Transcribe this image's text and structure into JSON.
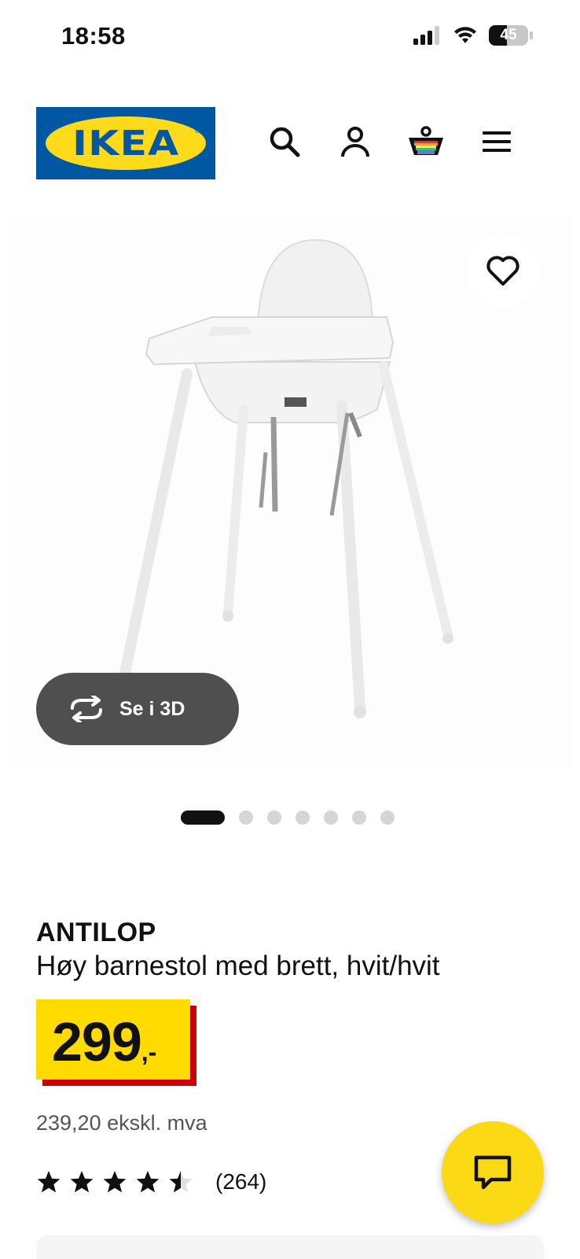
{
  "status_bar": {
    "time": "18:58",
    "battery": "45"
  },
  "header": {
    "logo_text": "IKEA",
    "logo_colors": {
      "background": "#0058a3",
      "oval": "#ffda1a"
    },
    "icons": [
      "search-icon",
      "account-icon",
      "basket-icon",
      "menu-icon"
    ]
  },
  "gallery": {
    "view_3d_label": "Se i 3D",
    "dot_count": 7,
    "active_index": 0
  },
  "product": {
    "name": "ANTILOP",
    "description": "Høy barnestol med brett, hvit/hvit",
    "price_integer": "299",
    "price_decimal": ",-",
    "price_ex_vat": "239,20 ekskl. mva",
    "rating_value": 4.5,
    "rating_count": "(264)"
  },
  "colors": {
    "price_yellow": "#ffdb00",
    "price_shadow_red": "#cc0008",
    "chat_yellow": "#fbd914",
    "dark_button": "#4f4f4f"
  }
}
